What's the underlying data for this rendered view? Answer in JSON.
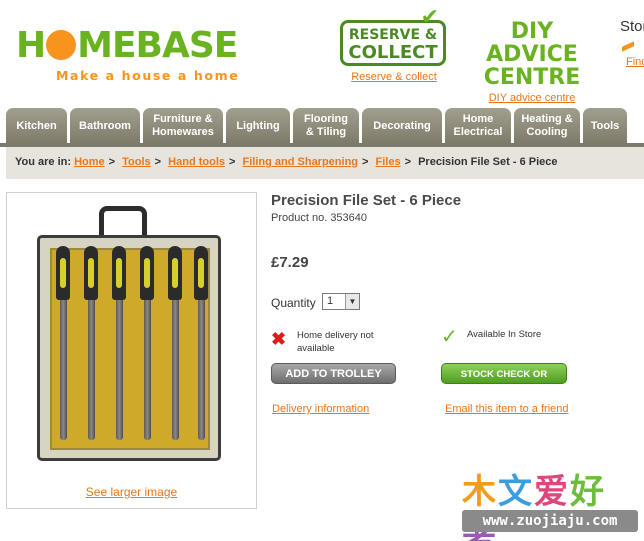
{
  "header": {
    "logo_text_pre": "H",
    "logo_text_post": "MEBASE",
    "logo_tagline": "Make a house a home",
    "reserve_collect": {
      "line1": "RESERVE &",
      "line2": "COLLECT",
      "link": "Reserve & collect"
    },
    "diy": {
      "title_line1": "DIY ADVICE",
      "title_line2": "CENTRE",
      "link": "DIY advice centre"
    },
    "stores": {
      "title": "Stor",
      "link": "Find"
    }
  },
  "nav": {
    "tabs": [
      {
        "label": "Kitchen"
      },
      {
        "label": "Bathroom"
      },
      {
        "label": "Furniture &\nHomewares"
      },
      {
        "label": "Lighting"
      },
      {
        "label": "Flooring\n& Tiling"
      },
      {
        "label": "Decorating"
      },
      {
        "label": "Home\nElectrical"
      },
      {
        "label": "Heating &\nCooling"
      },
      {
        "label": "Tools"
      }
    ]
  },
  "breadcrumb": {
    "prefix": "You are in:",
    "links": [
      "Home",
      "Tools",
      "Hand tools",
      "Filing and Sharpening",
      "Files"
    ],
    "current": "Precision File Set - 6 Piece"
  },
  "product": {
    "title": "Precision File Set - 6 Piece",
    "product_no": "Product no. 353640",
    "price": "£7.29",
    "quantity_label": "Quantity",
    "quantity_value": "1",
    "see_larger": "See larger image",
    "home_delivery": "Home delivery not available",
    "in_store": "Available In Store",
    "add_to_trolley": "ADD TO TROLLEY",
    "stock_check": "STOCK CHECK OR RESERVE",
    "delivery_info": "Delivery information",
    "email_friend": "Email this item to a friend"
  },
  "watermark": {
    "chars": [
      "木",
      "文",
      "爱",
      "好",
      "者"
    ],
    "url": "www.zuojiaju.com"
  },
  "colors": {
    "brand_green": "#69b320",
    "brand_orange": "#f7941d",
    "link_orange": "#e8761a",
    "nav_tab": "#8f8b7b"
  }
}
